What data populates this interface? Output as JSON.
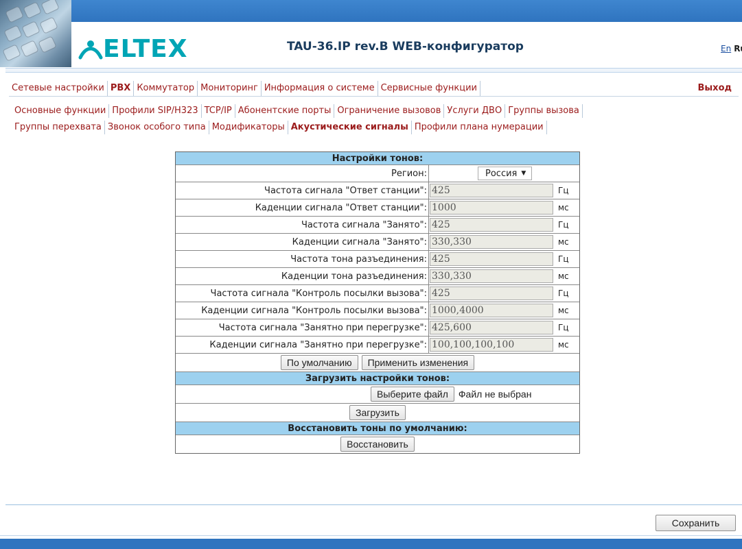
{
  "header": {
    "logo_text": "ELTEX",
    "title": "TAU-36.IP rev.B WEB-конфигуратор",
    "lang_en": "En",
    "lang_ru": "Ru"
  },
  "menu_main": {
    "items": [
      "Сетевые настройки",
      "PBX",
      "Коммутатор",
      "Мониторинг",
      "Информация о системе",
      "Сервисные функции"
    ],
    "active": "PBX",
    "exit_label": "Выход"
  },
  "menu_sub1": {
    "items": [
      "Основные функции",
      "Профили SIP/H323",
      "TCP/IP",
      "Абонентские порты",
      "Ограничение вызовов",
      "Услуги ДВО",
      "Группы вызова"
    ]
  },
  "menu_sub2": {
    "items": [
      "Группы перехвата",
      "Звонок особого типа",
      "Модификаторы",
      "Акустические сигналы",
      "Профили плана нумерации"
    ],
    "active": "Акустические сигналы"
  },
  "tones": {
    "header": "Настройки тонов:",
    "region_label": "Регион:",
    "region_value": "Россия",
    "rows": [
      {
        "label": "Частота сигнала \"Ответ станции\":",
        "value": "425",
        "unit": "Гц"
      },
      {
        "label": "Каденции сигнала \"Ответ станции\":",
        "value": "1000",
        "unit": "мс"
      },
      {
        "label": "Частота сигнала \"Занято\":",
        "value": "425",
        "unit": "Гц"
      },
      {
        "label": "Каденции сигнала \"Занято\":",
        "value": "330,330",
        "unit": "мс"
      },
      {
        "label": "Частота тона разъединения:",
        "value": "425",
        "unit": "Гц"
      },
      {
        "label": "Каденции тона разъединения:",
        "value": "330,330",
        "unit": "мс"
      },
      {
        "label": "Частота сигнала \"Контроль посылки вызова\":",
        "value": "425",
        "unit": "Гц"
      },
      {
        "label": "Каденции сигнала \"Контроль посылки вызова\":",
        "value": "1000,4000",
        "unit": "мс"
      },
      {
        "label": "Частота сигнала \"Занятно при перегрузке\":",
        "value": "425,600",
        "unit": "Гц"
      },
      {
        "label": "Каденции сигнала \"Занятно при перегрузке\":",
        "value": "100,100,100,100",
        "unit": "мс"
      }
    ],
    "default_button": "По умолчанию",
    "apply_button": "Применить изменения"
  },
  "upload": {
    "header": "Загрузить настройки тонов:",
    "choose_button": "Выберите файл",
    "no_file_text": "Файл не выбран",
    "upload_button": "Загрузить"
  },
  "restore": {
    "header": "Восстановить тоны по умолчанию:",
    "restore_button": "Восстановить"
  },
  "footer": {
    "save_button": "Сохранить"
  },
  "colors": {
    "header_bar": "#2f74bf",
    "logo": "#00a5b5",
    "menu_text": "#9b1b1b",
    "table_header": "#9dd1ef"
  }
}
